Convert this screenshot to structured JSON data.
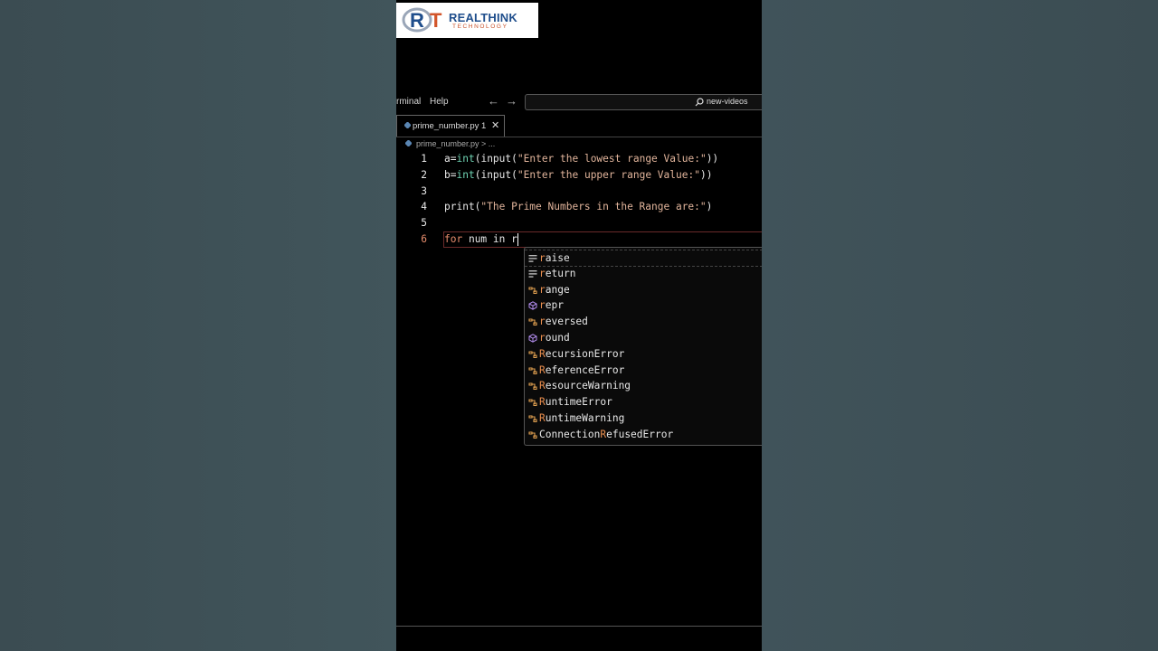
{
  "logo": {
    "brand": "REALTHINK",
    "sub": "TECHNOLOGY"
  },
  "menu": {
    "terminal": "rminal",
    "help": "Help"
  },
  "search": {
    "text": "new-videos"
  },
  "tab": {
    "name": "prime_number.py 1",
    "close": "✕"
  },
  "breadcrumb": {
    "text": "prime_number.py > ..."
  },
  "lines": [
    {
      "n": "1",
      "a": "a",
      "b": "=",
      "c": "int",
      "d": "(input(",
      "e": "\"Enter the lowest range Value:\"",
      "f": "))"
    },
    {
      "n": "2",
      "a": "b",
      "b": "=",
      "c": "int",
      "d": "(input(",
      "e": "\"Enter the upper range Value:\"",
      "f": "))"
    },
    {
      "n": "3"
    },
    {
      "n": "4",
      "a": "print(",
      "e": "\"The Prime Numbers in the Range are:\"",
      "f": ")"
    },
    {
      "n": "5"
    },
    {
      "n": "6",
      "kw": "for",
      "rest": " num in r"
    }
  ],
  "suggestions": [
    {
      "pre": "",
      "hl": "r",
      "post": "aise",
      "icon": "keyword-icon"
    },
    {
      "pre": "",
      "hl": "r",
      "post": "eturn",
      "icon": "keyword-icon"
    },
    {
      "pre": "",
      "hl": "r",
      "post": "ange",
      "icon": "class-icon"
    },
    {
      "pre": "",
      "hl": "r",
      "post": "epr",
      "icon": "function-icon"
    },
    {
      "pre": "",
      "hl": "r",
      "post": "eversed",
      "icon": "class-icon"
    },
    {
      "pre": "",
      "hl": "r",
      "post": "ound",
      "icon": "function-icon"
    },
    {
      "pre": "",
      "hl": "R",
      "post": "ecursionError",
      "icon": "class-icon"
    },
    {
      "pre": "",
      "hl": "R",
      "post": "eferenceError",
      "icon": "class-icon"
    },
    {
      "pre": "",
      "hl": "R",
      "post": "esourceWarning",
      "icon": "class-icon"
    },
    {
      "pre": "",
      "hl": "R",
      "post": "untimeError",
      "icon": "class-icon"
    },
    {
      "pre": "",
      "hl": "R",
      "post": "untimeWarning",
      "icon": "class-icon"
    },
    {
      "pre": "Connection",
      "hl": "R",
      "post": "efusedError",
      "icon": "class-icon"
    }
  ],
  "colors": {
    "keyword": "#e98e6e",
    "builtin": "#6fd3b3",
    "string": "#e1b49b",
    "match": "#e98e4e"
  }
}
